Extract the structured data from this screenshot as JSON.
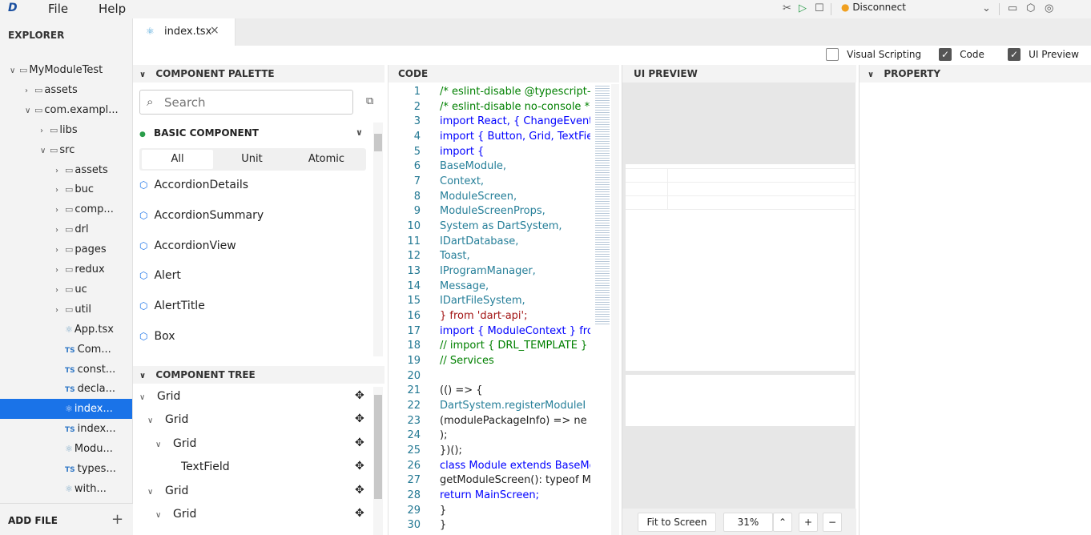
{
  "menubar": {
    "logo": "D",
    "file": "File",
    "help": "Help",
    "connection": "Disconnect"
  },
  "explorer": {
    "title": "EXPLORER",
    "add_file": "ADD FILE",
    "items": [
      {
        "label": "MyModuleTest",
        "type": "folder",
        "open": true,
        "level": 0
      },
      {
        "label": "assets",
        "type": "folder",
        "open": false,
        "level": 1
      },
      {
        "label": "com.exampl...",
        "type": "folder",
        "open": true,
        "level": 1
      },
      {
        "label": "libs",
        "type": "folder",
        "open": false,
        "level": 2
      },
      {
        "label": "src",
        "type": "folder",
        "open": true,
        "level": 2
      },
      {
        "label": "assets",
        "type": "folder",
        "open": false,
        "level": 3
      },
      {
        "label": "buc",
        "type": "folder",
        "open": false,
        "level": 3
      },
      {
        "label": "comp...",
        "type": "folder",
        "open": false,
        "level": 3
      },
      {
        "label": "drl",
        "type": "folder",
        "open": false,
        "level": 3
      },
      {
        "label": "pages",
        "type": "folder",
        "open": false,
        "level": 3
      },
      {
        "label": "redux",
        "type": "folder",
        "open": false,
        "level": 3
      },
      {
        "label": "uc",
        "type": "folder",
        "open": false,
        "level": 3
      },
      {
        "label": "util",
        "type": "folder",
        "open": false,
        "level": 3
      },
      {
        "label": "App.tsx",
        "type": "react",
        "level": 3
      },
      {
        "label": "Com...",
        "type": "ts",
        "level": 3
      },
      {
        "label": "const...",
        "type": "ts",
        "level": 3
      },
      {
        "label": "decla...",
        "type": "ts",
        "level": 3
      },
      {
        "label": "index...",
        "type": "react",
        "level": 3,
        "selected": true
      },
      {
        "label": "index...",
        "type": "ts",
        "level": 3
      },
      {
        "label": "Modu...",
        "type": "react",
        "level": 3
      },
      {
        "label": "types...",
        "type": "ts",
        "level": 3
      },
      {
        "label": "with...",
        "type": "react",
        "level": 3
      }
    ],
    "ts_badge": "TS"
  },
  "tabs": [
    {
      "label": "index.tsx"
    }
  ],
  "toggles": {
    "visual_scripting": "Visual Scripting",
    "code": "Code",
    "ui_preview": "UI Preview"
  },
  "palette": {
    "title": "COMPONENT PALETTE",
    "search_placeholder": "Search",
    "group": "BASIC COMPONENT",
    "segments": [
      "All",
      "Unit",
      "Atomic"
    ],
    "items": [
      "AccordionDetails",
      "AccordionSummary",
      "AccordionView",
      "Alert",
      "AlertTitle",
      "Box"
    ]
  },
  "component_tree": {
    "title": "COMPONENT TREE",
    "nodes": [
      {
        "label": "Grid",
        "level": 0,
        "expandable": true
      },
      {
        "label": "Grid",
        "level": 1,
        "expandable": true
      },
      {
        "label": "Grid",
        "level": 2,
        "expandable": true
      },
      {
        "label": "TextField",
        "level": 3,
        "expandable": false
      },
      {
        "label": "Grid",
        "level": 1,
        "expandable": true
      },
      {
        "label": "Grid",
        "level": 2,
        "expandable": true
      }
    ]
  },
  "code": {
    "title": "CODE",
    "lines": [
      "/* eslint-disable @typescript-e",
      "/* eslint-disable no-console *",
      "import React, { ChangeEvent",
      "import { Button, Grid, TextFie",
      "import {",
      "  BaseModule,",
      "  Context,",
      "  ModuleScreen,",
      "  ModuleScreenProps,",
      "  System as DartSystem,",
      "  IDartDatabase,",
      "  Toast,",
      "  IProgramManager,",
      "  Message,",
      "  IDartFileSystem,",
      "} from 'dart-api';",
      "import { ModuleContext } fro",
      "// import { DRL_TEMPLATE } fr",
      "// Services",
      "",
      "(() => {",
      "  DartSystem.registerModuleI",
      "    (modulePackageInfo) => ne",
      "  );",
      "})();",
      "class Module extends BaseMo",
      "  getModuleScreen(): typeof M",
      "    return MainScreen;",
      "  }",
      "}"
    ]
  },
  "preview": {
    "title": "UI PREVIEW",
    "fit_to_screen": "Fit to Screen",
    "zoom": "31%"
  },
  "property": {
    "title": "PROPERTY"
  },
  "colors": {
    "accent": "#1a73e8",
    "comment": "#008000",
    "keyword": "#0000ff",
    "type": "#267f99",
    "string": "#a31515",
    "status_dot": "#f0a020"
  }
}
